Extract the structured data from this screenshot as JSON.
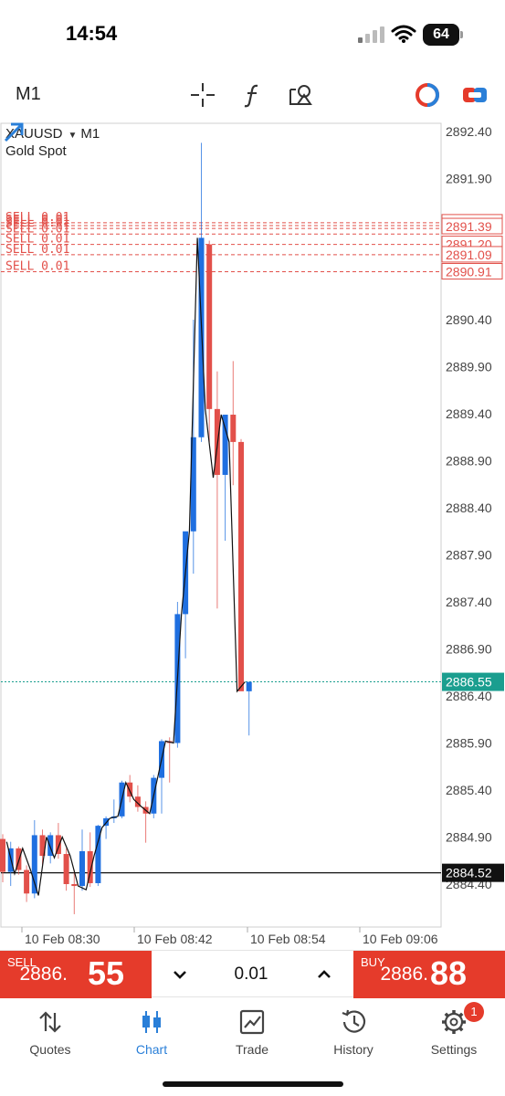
{
  "status_bar": {
    "time": "14:54",
    "battery": "64"
  },
  "toolbar": {
    "timeframe": "M1",
    "icons": [
      "crosshair-icon",
      "indicator-function-icon",
      "objects-shapes-icon",
      "one-click-trading-icon",
      "trade-mode-icon"
    ]
  },
  "chart": {
    "symbol": "XAUUSD",
    "timeframe": "M1",
    "description": "Gold Spot",
    "colors": {
      "bull": "#1f6fe0",
      "bear": "#e2504a",
      "bid_line": "#1a9e8f",
      "order_line": "#e2504a",
      "trade_btn": "#e53b2b",
      "accent": "#2a7fd8"
    },
    "price_labels": [
      "2892.40",
      "2891.90",
      "2890.40",
      "2889.90",
      "2889.40",
      "2888.90",
      "2888.40",
      "2887.90",
      "2887.40",
      "2886.90",
      "2886.40",
      "2885.90",
      "2885.40",
      "2884.90",
      "2884.40"
    ],
    "time_labels": [
      "10 Feb 08:30",
      "10 Feb 08:42",
      "10 Feb 08:54",
      "10 Feb 09:06"
    ],
    "orders": [
      {
        "label": "SELL 0.01",
        "price": 2891.43
      },
      {
        "label": "SELL 0.01",
        "price": 2891.4
      },
      {
        "label": "SELL 0.01",
        "price": 2891.37
      },
      {
        "label": "SELL 0.01",
        "price": 2891.31
      },
      {
        "label": "SELL 0.01",
        "price": 2891.2
      },
      {
        "label": "SELL 0.01",
        "price": 2891.09
      },
      {
        "label": "SELL 0.01",
        "price": 2890.91
      }
    ],
    "order_price_tags": [
      "2891.43",
      "2891.39",
      "2891.20",
      "2891.09",
      "2890.91"
    ],
    "bid": {
      "price": 2886.55,
      "label": "2886.55"
    },
    "horizontal_line": {
      "price": 2884.52,
      "label": "2884.52"
    }
  },
  "chart_data": {
    "type": "candlestick",
    "symbol": "XAUUSD",
    "timeframe": "M1",
    "ylim": [
      2884.0,
      2892.5
    ],
    "series": [
      {
        "o": 2884.88,
        "h": 2884.93,
        "l": 2884.42,
        "c": 2884.53
      },
      {
        "o": 2884.53,
        "h": 2884.85,
        "l": 2884.38,
        "c": 2884.78
      },
      {
        "o": 2884.78,
        "h": 2884.8,
        "l": 2884.5,
        "c": 2884.55
      },
      {
        "o": 2884.55,
        "h": 2884.6,
        "l": 2884.21,
        "c": 2884.3
      },
      {
        "o": 2884.3,
        "h": 2885.08,
        "l": 2884.25,
        "c": 2884.92
      },
      {
        "o": 2884.92,
        "h": 2884.98,
        "l": 2884.6,
        "c": 2884.7
      },
      {
        "o": 2884.7,
        "h": 2884.95,
        "l": 2884.62,
        "c": 2884.92
      },
      {
        "o": 2884.92,
        "h": 2885.05,
        "l": 2884.67,
        "c": 2884.72
      },
      {
        "o": 2884.72,
        "h": 2884.78,
        "l": 2884.33,
        "c": 2884.4
      },
      {
        "o": 2884.4,
        "h": 2884.55,
        "l": 2884.08,
        "c": 2884.38
      },
      {
        "o": 2884.38,
        "h": 2884.98,
        "l": 2884.33,
        "c": 2884.75
      },
      {
        "o": 2884.75,
        "h": 2884.95,
        "l": 2884.37,
        "c": 2884.41
      },
      {
        "o": 2884.41,
        "h": 2885.03,
        "l": 2884.38,
        "c": 2885.02
      },
      {
        "o": 2885.02,
        "h": 2885.12,
        "l": 2884.88,
        "c": 2885.1
      },
      {
        "o": 2885.1,
        "h": 2885.3,
        "l": 2885.05,
        "c": 2885.12
      },
      {
        "o": 2885.12,
        "h": 2885.5,
        "l": 2885.1,
        "c": 2885.48
      },
      {
        "o": 2885.48,
        "h": 2885.56,
        "l": 2885.27,
        "c": 2885.33
      },
      {
        "o": 2885.33,
        "h": 2885.45,
        "l": 2885.17,
        "c": 2885.22
      },
      {
        "o": 2885.22,
        "h": 2885.28,
        "l": 2884.84,
        "c": 2885.15
      },
      {
        "o": 2885.15,
        "h": 2885.56,
        "l": 2885.1,
        "c": 2885.53
      },
      {
        "o": 2885.53,
        "h": 2885.94,
        "l": 2885.15,
        "c": 2885.92
      },
      {
        "o": 2885.92,
        "h": 2885.96,
        "l": 2885.48,
        "c": 2885.9
      },
      {
        "o": 2885.9,
        "h": 2887.4,
        "l": 2885.85,
        "c": 2887.27
      },
      {
        "o": 2887.27,
        "h": 2887.3,
        "l": 2886.8,
        "c": 2888.15
      },
      {
        "o": 2888.15,
        "h": 2890.4,
        "l": 2887.7,
        "c": 2889.15
      },
      {
        "o": 2889.15,
        "h": 2892.28,
        "l": 2889.1,
        "c": 2891.27
      },
      {
        "o": 2891.2,
        "h": 2891.24,
        "l": 2889.1,
        "c": 2889.45
      },
      {
        "o": 2889.45,
        "h": 2889.85,
        "l": 2887.33,
        "c": 2888.75
      },
      {
        "o": 2888.75,
        "h": 2889.14,
        "l": 2888.05,
        "c": 2889.39
      },
      {
        "o": 2889.39,
        "h": 2889.96,
        "l": 2888.64,
        "c": 2889.1
      },
      {
        "o": 2889.1,
        "h": 2889.13,
        "l": 2888.38,
        "c": 2886.45
      },
      {
        "o": 2886.45,
        "h": 2886.55,
        "l": 2885.98,
        "c": 2886.55
      }
    ],
    "close_line": [
      2884.85,
      2884.51,
      2884.78,
      2884.55,
      2884.28,
      2884.9,
      2884.68,
      2884.9,
      2884.7,
      2884.38,
      2884.34,
      2884.7,
      2885.0,
      2885.1,
      2885.12,
      2885.48,
      2885.3,
      2885.22,
      2885.15,
      2885.53,
      2885.92,
      2885.9,
      2887.27,
      2888.15,
      2891.27,
      2889.45,
      2888.72,
      2889.39,
      2889.1,
      2886.45,
      2886.55
    ]
  },
  "trade_bar": {
    "sell_label": "SELL",
    "sell_price_main": "2886.",
    "sell_price_big": "55",
    "lot": "0.01",
    "buy_label": "BUY",
    "buy_price_main": "2886.",
    "buy_price_big": "88"
  },
  "nav": {
    "items": [
      {
        "label": "Quotes",
        "icon": "quotes-arrows-icon"
      },
      {
        "label": "Chart",
        "icon": "chart-candles-icon"
      },
      {
        "label": "Trade",
        "icon": "trade-chart-icon"
      },
      {
        "label": "History",
        "icon": "history-clock-icon"
      },
      {
        "label": "Settings",
        "icon": "gear-icon"
      }
    ],
    "settings_badge": "1"
  }
}
